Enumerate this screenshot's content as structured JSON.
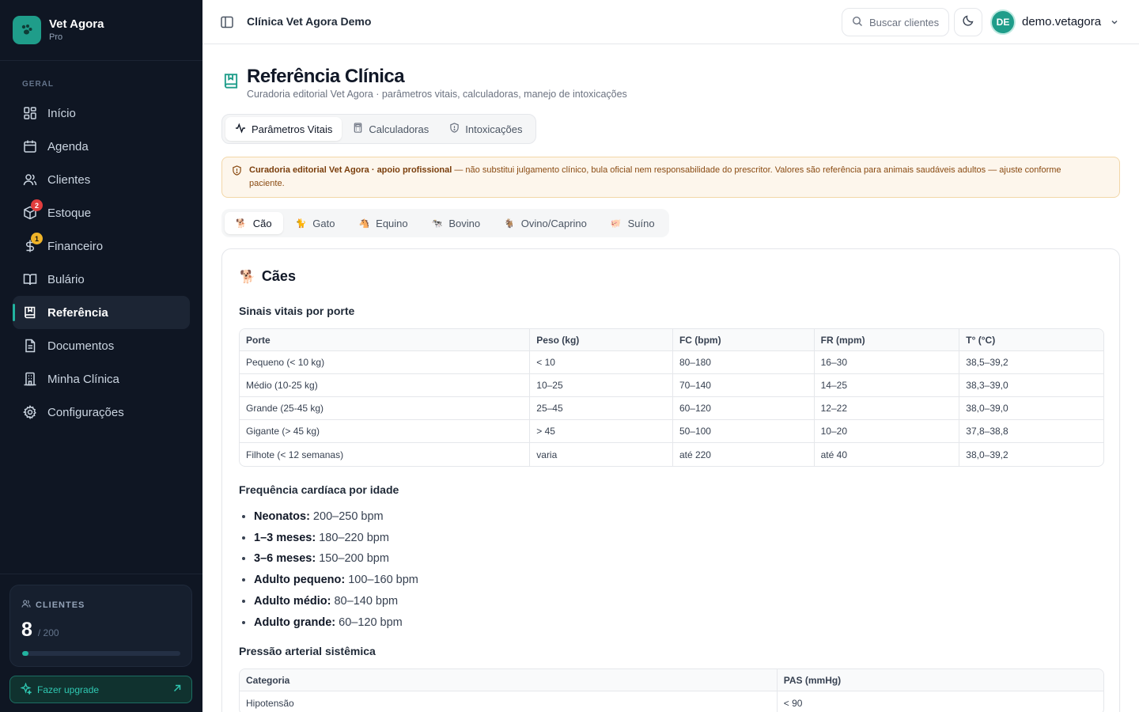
{
  "sidebar": {
    "brand_name": "Vet Agora",
    "brand_plan": "Pro",
    "section_label": "GERAL",
    "items": [
      {
        "label": "Início",
        "icon": "grid-icon"
      },
      {
        "label": "Agenda",
        "icon": "calendar-icon"
      },
      {
        "label": "Clientes",
        "icon": "users-icon"
      },
      {
        "label": "Estoque",
        "icon": "box-icon",
        "badge": "2"
      },
      {
        "label": "Financeiro",
        "icon": "dollar-icon",
        "badge": "1"
      },
      {
        "label": "Bulário",
        "icon": "book-open-icon"
      },
      {
        "label": "Referência",
        "icon": "bookmark-book-icon",
        "active": true
      },
      {
        "label": "Documentos",
        "icon": "document-icon"
      },
      {
        "label": "Minha Clínica",
        "icon": "building-icon"
      },
      {
        "label": "Configurações",
        "icon": "gear-icon"
      }
    ],
    "clients_card": {
      "label": "CLIENTES",
      "count": "8",
      "max": "/ 200",
      "progress": 0.04
    },
    "upgrade_label": "Fazer upgrade"
  },
  "topbar": {
    "clinic_name": "Clínica Vet Agora Demo",
    "search_placeholder": "Buscar clientes",
    "avatar_initials": "DE",
    "user_name": "demo.vetagora"
  },
  "page": {
    "title": "Referência Clínica",
    "subtitle": "Curadoria editorial Vet Agora · parâmetros vitais, calculadoras, manejo de intoxicações",
    "tabs": [
      "Parâmetros Vitais",
      "Calculadoras",
      "Intoxicações"
    ],
    "notice_bold": "Curadoria editorial Vet Agora · apoio profissional",
    "notice_text": " — não substitui julgamento clínico, bula oficial nem responsabilidade do prescritor. Valores são referência para animais saudáveis adultos — ajuste conforme paciente.",
    "species": [
      {
        "label": "Cão",
        "emoji": "🐕"
      },
      {
        "label": "Gato",
        "emoji": "🐈"
      },
      {
        "label": "Equino",
        "emoji": "🐴"
      },
      {
        "label": "Bovino",
        "emoji": "🐄"
      },
      {
        "label": "Ovino/Caprino",
        "emoji": "🐐"
      },
      {
        "label": "Suíno",
        "emoji": "🐖"
      }
    ]
  },
  "card": {
    "title": "Cães",
    "title_emoji": "🐕",
    "vitals_heading": "Sinais vitais por porte",
    "vitals_headers": [
      "Porte",
      "Peso (kg)",
      "FC (bpm)",
      "FR (mpm)",
      "T° (°C)"
    ],
    "vitals_rows": [
      [
        "Pequeno (< 10 kg)",
        "< 10",
        "80–180",
        "16–30",
        "38,5–39,2"
      ],
      [
        "Médio (10-25 kg)",
        "10–25",
        "70–140",
        "14–25",
        "38,3–39,0"
      ],
      [
        "Grande (25-45 kg)",
        "25–45",
        "60–120",
        "12–22",
        "38,0–39,0"
      ],
      [
        "Gigante (> 45 kg)",
        "> 45",
        "50–100",
        "10–20",
        "37,8–38,8"
      ],
      [
        "Filhote (< 12 semanas)",
        "varia",
        "até 220",
        "até 40",
        "38,0–39,2"
      ]
    ],
    "hr_heading": "Frequência cardíaca por idade",
    "hr_items": [
      {
        "label": "Neonatos:",
        "value": " 200–250 bpm"
      },
      {
        "label": "1–3 meses:",
        "value": " 180–220 bpm"
      },
      {
        "label": "3–6 meses:",
        "value": " 150–200 bpm"
      },
      {
        "label": "Adulto pequeno:",
        "value": " 100–160 bpm"
      },
      {
        "label": "Adulto médio:",
        "value": " 80–140 bpm"
      },
      {
        "label": "Adulto grande:",
        "value": " 60–120 bpm"
      }
    ],
    "pressure_heading": "Pressão arterial sistêmica",
    "pressure_headers": [
      "Categoria",
      "PAS (mmHg)"
    ],
    "pressure_rows": [
      [
        "Hipotensão",
        "< 90"
      ]
    ]
  },
  "colors": {
    "accent": "#1f9d8a",
    "sidebar_bg": "#0f1623",
    "badge_red": "#e23d3d",
    "badge_yellow": "#f0b429"
  }
}
